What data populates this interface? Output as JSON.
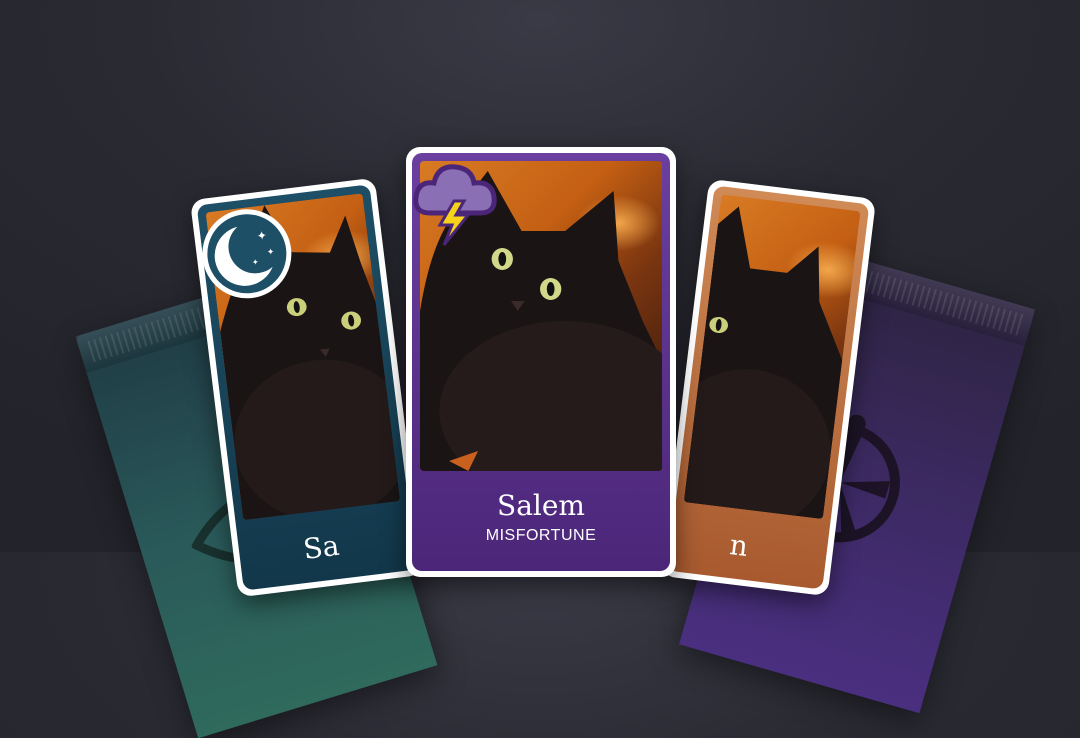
{
  "cards": {
    "left": {
      "name": "Sa",
      "icon": "moon-stars-icon"
    },
    "center": {
      "name": "Salem",
      "trait": "MISFORTUNE",
      "icon": "storm-cloud-icon"
    },
    "right": {
      "name": "n",
      "icon": "none"
    }
  },
  "packs": {
    "left": {
      "icon": "cat-eye-icon",
      "color": "#2f6a5c"
    },
    "right": {
      "icon": "wheel-of-fortune-icon",
      "color": "#4a2f80"
    }
  },
  "colors": {
    "background": "#2a2a33",
    "center_card": "#6b3fa0",
    "left_card": "#1d4f66",
    "right_card": "#a85a2e"
  }
}
